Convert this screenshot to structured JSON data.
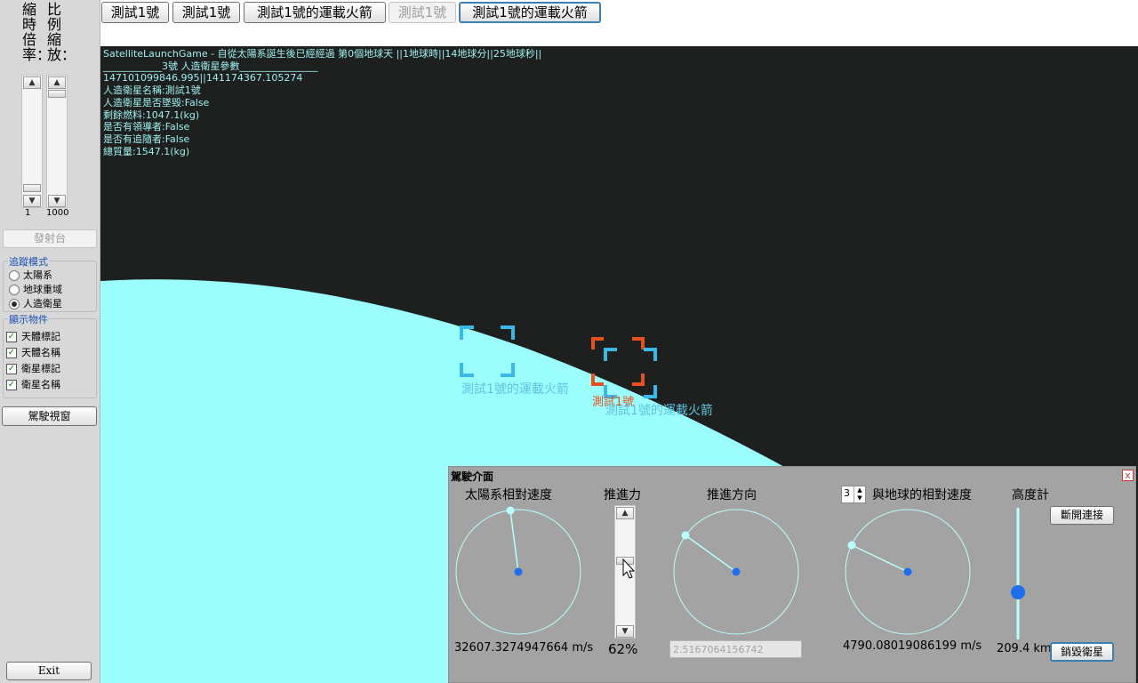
{
  "left": {
    "vertical_labels": [
      "縮時倍率：",
      "比例縮放："
    ],
    "scroll_values": [
      "1",
      "1000"
    ],
    "launch_pad": "發射台",
    "tracking_group": {
      "title": "追蹤模式",
      "options": [
        "太陽系",
        "地球重域",
        "人造衛星"
      ],
      "selected": "人造衛星"
    },
    "display_group": {
      "title": "顯示物件",
      "options": [
        "天體標記",
        "天體名稱",
        "衛星標記",
        "衛星名稱"
      ]
    },
    "pilot_window_button": "駕駛視窗",
    "exit_button": "Exit"
  },
  "top_buttons": [
    "測試1號",
    "測試1號",
    "測試1號的運載火箭",
    "測試1號",
    "測試1號的運載火箭"
  ],
  "hud": {
    "title": "SatelliteLaunchGame - 自從太陽系誕生後已經經過 第0個地球天 ||1地球時||14地球分||25地球秒||",
    "header": "____________3號 人造衛星參數________________",
    "coords": "147101099846.995||141174367.105274",
    "name": "人造衛星名稱:測試1號",
    "crashed": "人造衛星是否墜毀:False",
    "fuel": "剩餘燃料:1047.1(kg)",
    "leader": "是否有領導者:False",
    "follower": "是否有追隨者:False",
    "mass": "總質量:1547.1(kg)"
  },
  "markers": {
    "rocket_label": "測試1號的運載火箭",
    "satellite_label": "測試1號",
    "rocket_label_2": "測試1號的運載火箭"
  },
  "pilot": {
    "title": "駕駛介面",
    "close": "x",
    "solar_speed_label": "太陽系相對速度",
    "solar_speed_value": "32607.3274947664 m/s",
    "thrust_label": "推進力",
    "thrust_value": "62%",
    "thrust_level": 0.62,
    "direction_label": "推進方向",
    "direction_value": "2.5167064156742",
    "stepper_value": "3",
    "earth_speed_label": "與地球的相對速度",
    "earth_speed_value": "4790.08019086199 m/s",
    "altimeter_label": "高度計",
    "altitude_value": "209.4 km",
    "disconnect_button": "斷開連接",
    "destroy_button": "銷毀衛星"
  },
  "colors": {
    "space": "#1d201e",
    "earth": "#9cfdfd",
    "hud_text": "#9fefef",
    "rocket_marker": "#3cb8e8",
    "satellite_marker": "#e8501e",
    "panel": "#a3a3a3",
    "dial_line": "#b8ffff",
    "dial_center": "#1e6ef0"
  }
}
